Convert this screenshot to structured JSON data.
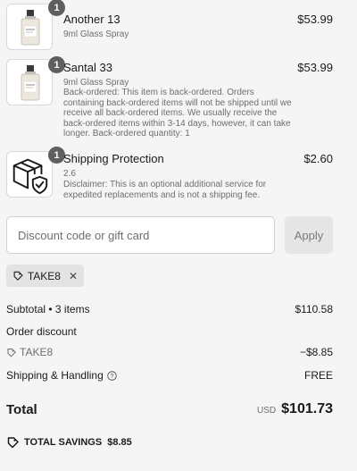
{
  "items": [
    {
      "name": "Another 13",
      "variant": "9ml Glass Spray",
      "note": "",
      "price": "$53.99",
      "quantity": "1",
      "image": "perfume-bottle"
    },
    {
      "name": "Santal 33",
      "variant": "9ml Glass Spray",
      "note": "Back-ordered: This item is back-ordered. Orders containing back-ordered items will not be shipped until we receive all back-ordered items. We usually receive the back-ordered items within 3-14 days, however, it can take longer. Back-ordered quantity: 1",
      "price": "$53.99",
      "quantity": "1",
      "image": "perfume-bottle"
    },
    {
      "name": "Shipping Protection",
      "variant": "2.6",
      "note": "Disclaimer: This is an optional additional service for expedited replacements and is not a shipping fee.",
      "price": "$2.60",
      "quantity": "1",
      "image": "package-shield-icon"
    }
  ],
  "discount": {
    "placeholder": "Discount code or gift card",
    "apply_label": "Apply",
    "applied_code": "TAKE8"
  },
  "summary": {
    "subtotal_label": "Subtotal • 3 items",
    "subtotal_value": "$110.58",
    "order_discount_label": "Order discount",
    "discount_code": "TAKE8",
    "discount_value": "−$8.85",
    "shipping_label": "Shipping & Handling",
    "shipping_value": "FREE",
    "total_label": "Total",
    "currency": "USD",
    "total_value": "$101.73",
    "savings_label": "TOTAL SAVINGS",
    "savings_value": "$8.85"
  }
}
